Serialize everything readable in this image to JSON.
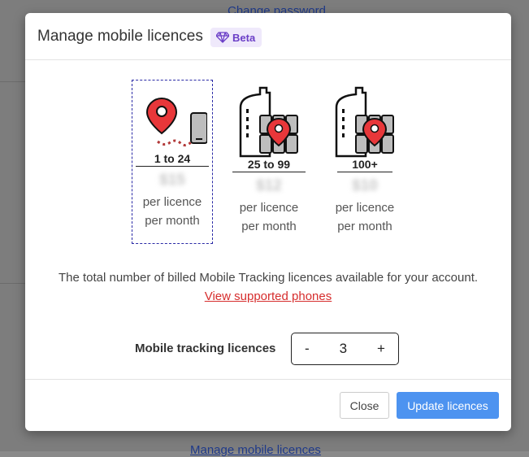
{
  "background": {
    "top_link": "Change password",
    "bottom_link": "Manage mobile licences"
  },
  "modal": {
    "title": "Manage mobile licences",
    "badge": {
      "label": "Beta",
      "icon": "diamond-icon",
      "color": "#6b3fc7"
    },
    "tiers": [
      {
        "range": "1 to 24",
        "price": "$15",
        "unit_line1": "per licence",
        "unit_line2": "per month",
        "icon": "pin-and-phone-icon",
        "selected": true
      },
      {
        "range": "25 to 99",
        "price": "$12",
        "unit_line1": "per licence",
        "unit_line2": "per month",
        "icon": "building-fleet-pin-icon",
        "selected": false
      },
      {
        "range": "100+",
        "price": "$10",
        "unit_line1": "per licence",
        "unit_line2": "per month",
        "icon": "building-fleet-pin-icon",
        "selected": false
      }
    ],
    "description": "The total number of billed Mobile Tracking licences available for your account.",
    "phones_link": "View supported phones",
    "licence_count": {
      "label": "Mobile tracking licences",
      "decrement": "-",
      "value": "3",
      "increment": "+"
    },
    "buttons": {
      "close": "Close",
      "update": "Update licences"
    },
    "colors": {
      "accent": "#4d93f0",
      "link": "#d62d2d",
      "pin": "#e8373a"
    }
  }
}
